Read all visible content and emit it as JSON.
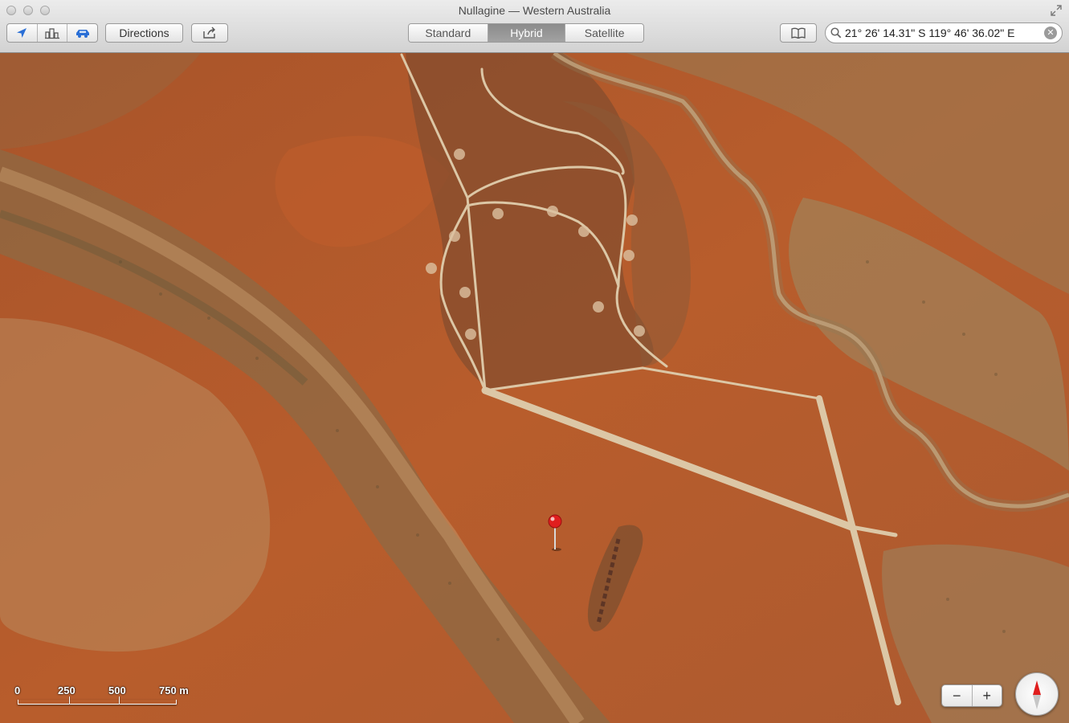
{
  "window": {
    "title": "Nullagine — Western Australia"
  },
  "toolbar": {
    "location_icon": "location-arrow-icon",
    "view_3d_icon": "3d-buildings-icon",
    "traffic_icon": "car-icon",
    "directions_label": "Directions",
    "share_icon": "share-icon",
    "map_types": [
      {
        "label": "Standard",
        "active": false
      },
      {
        "label": "Hybrid",
        "active": true
      },
      {
        "label": "Satellite",
        "active": false
      }
    ],
    "bookmarks_icon": "book-icon",
    "search": {
      "value": "21° 26' 14.31\" S 119° 46' 36.02\" E",
      "icon": "magnifier-icon"
    }
  },
  "map": {
    "scale_labels": [
      "0",
      "250",
      "500",
      "750 m"
    ],
    "zoom_out_label": "−",
    "zoom_in_label": "+",
    "colors": {
      "terrain_red": "#b35a2a",
      "terrain_dark": "#7a4a2c",
      "track": "#dcc7a6",
      "pin": "#e01e1e"
    }
  }
}
